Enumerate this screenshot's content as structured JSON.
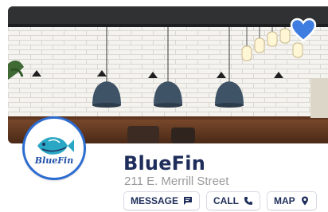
{
  "restaurant": {
    "name": "BlueFin",
    "address": "211 E. Merrill Street",
    "logo_text": "BlueFin"
  },
  "hero": {
    "image_icon": "restaurant-interior-photo",
    "favorite_icon": "heart-icon"
  },
  "actions": [
    {
      "label": "MESSAGE",
      "icon": "chat-icon"
    },
    {
      "label": "CALL",
      "icon": "phone-icon"
    },
    {
      "label": "MAP",
      "icon": "map-pin-icon"
    }
  ],
  "colors": {
    "brand_navy": "#1f2d5a",
    "accent_blue": "#2c6cd1",
    "favorite_blue": "#3f7de0",
    "muted_text": "#9a9a9a"
  }
}
